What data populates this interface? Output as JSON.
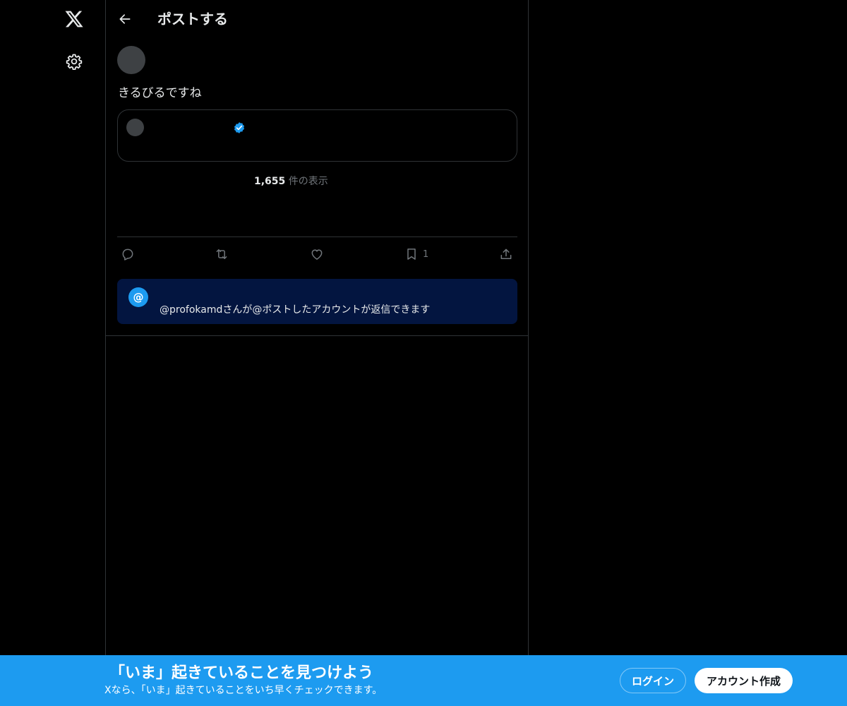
{
  "header": {
    "title": "ポストする"
  },
  "post": {
    "text": "きるびるですね",
    "views_count": "1,655",
    "views_label": "件の表示"
  },
  "actions": {
    "bookmark_count": "1"
  },
  "reply_notice": {
    "icon_label": "@",
    "text": "@profokamdさんが@ポストしたアカウントが返信できます"
  },
  "bottom_bar": {
    "title": "「いま」起きていることを見つけよう",
    "subtitle": "Xなら、「いま」起きていることをいち早くチェックできます。",
    "login_label": "ログイン",
    "signup_label": "アカウント作成"
  },
  "colors": {
    "background": "#000000",
    "accent": "#1d9bf0",
    "border": "#2f3336",
    "muted_text": "#71767b",
    "notice_bg": "#031540"
  },
  "icons": [
    "x-logo-icon",
    "gear-icon",
    "back-arrow-icon",
    "verified-badge-icon",
    "reply-icon",
    "repost-icon",
    "like-icon",
    "bookmark-icon",
    "share-icon"
  ]
}
